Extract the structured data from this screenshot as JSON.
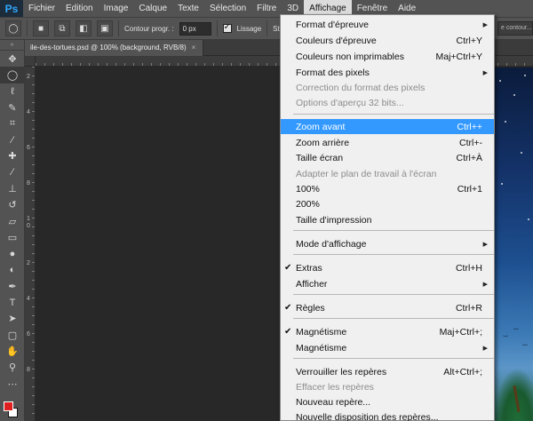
{
  "menubar": {
    "logo": "Ps",
    "items": [
      "Fichier",
      "Edition",
      "Image",
      "Calque",
      "Texte",
      "Sélection",
      "Filtre",
      "3D",
      "Affichage",
      "Fenêtre",
      "Aide"
    ]
  },
  "optionsbar": {
    "contour_label": "Contour progr. :",
    "contour_value": "0 px",
    "lissage_label": "Lissage",
    "style_label": "Style :",
    "right_label": "e contour..."
  },
  "tab": {
    "title": "ile-des-tortues.psd @ 100% (background, RVB/8)",
    "close": "×"
  },
  "rulers": {
    "v_numbers": [
      "2",
      "4",
      "6",
      "8",
      "1",
      "0",
      "2",
      "4",
      "6",
      "8"
    ]
  },
  "swatches": {
    "foreground": "#e02020",
    "background": "#ffffff"
  },
  "menu": {
    "items": [
      {
        "label": "Format d'épreuve",
        "shortcut": "",
        "submenu": true,
        "disabled": false,
        "checked": false,
        "highlight": false
      },
      {
        "label": "Couleurs d'épreuve",
        "shortcut": "Ctrl+Y",
        "submenu": false,
        "disabled": false,
        "checked": false,
        "highlight": false
      },
      {
        "label": "Couleurs non imprimables",
        "shortcut": "Maj+Ctrl+Y",
        "submenu": false,
        "disabled": false,
        "checked": false,
        "highlight": false
      },
      {
        "label": "Format des pixels",
        "shortcut": "",
        "submenu": true,
        "disabled": false,
        "checked": false,
        "highlight": false
      },
      {
        "label": "Correction du format des pixels",
        "shortcut": "",
        "submenu": false,
        "disabled": true,
        "checked": false,
        "highlight": false
      },
      {
        "label": "Options d'aperçu 32 bits...",
        "shortcut": "",
        "submenu": false,
        "disabled": true,
        "checked": false,
        "highlight": false
      },
      {
        "label": "Zoom avant",
        "shortcut": "Ctrl++",
        "submenu": false,
        "disabled": false,
        "checked": false,
        "highlight": true
      },
      {
        "label": "Zoom arrière",
        "shortcut": "Ctrl+-",
        "submenu": false,
        "disabled": false,
        "checked": false,
        "highlight": false
      },
      {
        "label": "Taille écran",
        "shortcut": "Ctrl+À",
        "submenu": false,
        "disabled": false,
        "checked": false,
        "highlight": false
      },
      {
        "label": "Adapter le plan de travail à l'écran",
        "shortcut": "",
        "submenu": false,
        "disabled": true,
        "checked": false,
        "highlight": false
      },
      {
        "label": "100%",
        "shortcut": "Ctrl+1",
        "submenu": false,
        "disabled": false,
        "checked": false,
        "highlight": false
      },
      {
        "label": "200%",
        "shortcut": "",
        "submenu": false,
        "disabled": false,
        "checked": false,
        "highlight": false
      },
      {
        "label": "Taille d'impression",
        "shortcut": "",
        "submenu": false,
        "disabled": false,
        "checked": false,
        "highlight": false
      },
      {
        "label": "Mode d'affichage",
        "shortcut": "",
        "submenu": true,
        "disabled": false,
        "checked": false,
        "highlight": false
      },
      {
        "label": "Extras",
        "shortcut": "Ctrl+H",
        "submenu": false,
        "disabled": false,
        "checked": true,
        "highlight": false
      },
      {
        "label": "Afficher",
        "shortcut": "",
        "submenu": true,
        "disabled": false,
        "checked": false,
        "highlight": false
      },
      {
        "label": "Règles",
        "shortcut": "Ctrl+R",
        "submenu": false,
        "disabled": false,
        "checked": true,
        "highlight": false
      },
      {
        "label": "Magnétisme",
        "shortcut": "Maj+Ctrl+;",
        "submenu": false,
        "disabled": false,
        "checked": true,
        "highlight": false
      },
      {
        "label": "Magnétisme",
        "shortcut": "",
        "submenu": true,
        "disabled": false,
        "checked": false,
        "highlight": false
      },
      {
        "label": "Verrouiller les repères",
        "shortcut": "Alt+Ctrl+;",
        "submenu": false,
        "disabled": false,
        "checked": false,
        "highlight": false
      },
      {
        "label": "Effacer les repères",
        "shortcut": "",
        "submenu": false,
        "disabled": true,
        "checked": false,
        "highlight": false
      },
      {
        "label": "Nouveau repère...",
        "shortcut": "",
        "submenu": false,
        "disabled": false,
        "checked": false,
        "highlight": false
      },
      {
        "label": "Nouvelle disposition des repères...",
        "shortcut": "",
        "submenu": false,
        "disabled": false,
        "checked": false,
        "highlight": false
      }
    ]
  }
}
